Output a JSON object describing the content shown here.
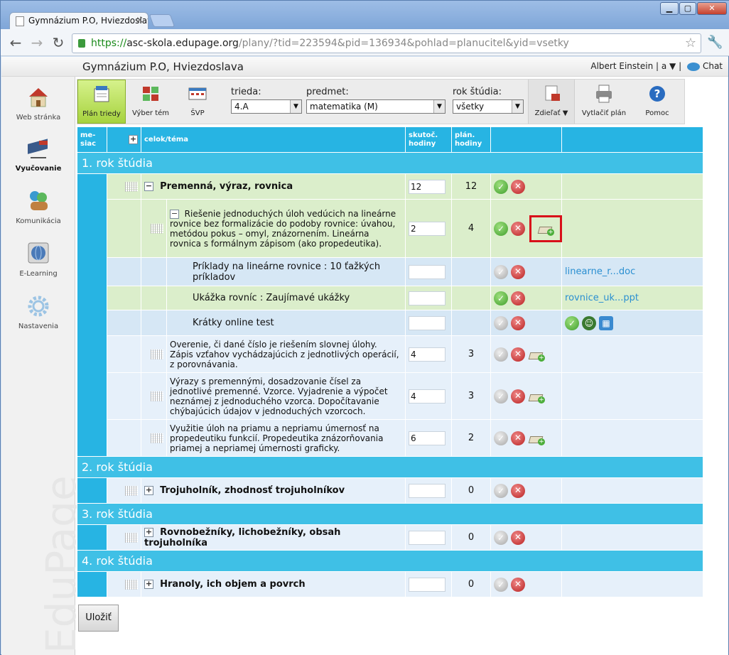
{
  "browser": {
    "tab_title": "Gymnázium P.O, Hviezdoslava",
    "url_scheme": "https://",
    "url_host": "asc-skola.edupage.org",
    "url_path": "/plany/?tid=223594&pid=136934&pohlad=planucitel&yid=vsetky"
  },
  "header": {
    "school": "Gymnázium P.O, Hviezdoslava",
    "user": "Albert Einstein",
    "user_menu": "| a ▼ |",
    "chat": "Chat"
  },
  "sidebar": [
    {
      "label": "Web stránka",
      "icon": "house-icon"
    },
    {
      "label": "Vyučovanie",
      "icon": "teaching-icon",
      "active": true
    },
    {
      "label": "Komunikácia",
      "icon": "people-icon"
    },
    {
      "label": "E-Learning",
      "icon": "globe-icon"
    },
    {
      "label": "Nastavenia",
      "icon": "gear-icon"
    }
  ],
  "watermark": "EduPage",
  "ribbon": {
    "plan_triedy": "Plán triedy",
    "vyber_tem": "Výber tém",
    "svp": "ŠVP",
    "trieda_label": "trieda:",
    "trieda_value": "4.A",
    "predmet_label": "predmet:",
    "predmet_value": "matematika (M)",
    "rok_label": "rok štúdia:",
    "rok_value": "všetky",
    "zdielat": "Zdieľať ▼",
    "vytlacit": "Vytlačiť plán",
    "pomoc": "Pomoc"
  },
  "table": {
    "col_mesiac": "me-siac",
    "col_celok": "celok/téma",
    "col_skutoc": "skutoč. hodiny",
    "col_plan": "plán. hodiny",
    "years": [
      "1. rok štúdia",
      "2. rok štúdia",
      "3. rok štúdia",
      "4. rok štúdia"
    ],
    "rows": {
      "r1": {
        "text": "Premenná, výraz, rovnica",
        "skutoc": "12",
        "plan": "12"
      },
      "r2": {
        "text": "Riešenie jednoduchých úloh vedúcich na lineárne rovnice bez formalizácie do podoby rovnice: úvahou, metódou pokus – omyl, znázornením. Lineárna rovnica s formálnym zápisom (ako propedeutika).",
        "skutoc": "2",
        "plan": "4"
      },
      "r3": {
        "text": "Príklady na lineárne rovnice : 10 ťažkých príkladov",
        "link": "linearne_r...doc"
      },
      "r4": {
        "text": "Ukážka rovníc : Zaujímavé ukážky",
        "link": "rovnice_uk...ppt"
      },
      "r5": {
        "text": "Krátky online test"
      },
      "r6": {
        "text": "Overenie, či dané číslo je riešením slovnej úlohy. Zápis vzťahov vychádzajúcich z jednotlivých operácií, z porovnávania.",
        "skutoc": "4",
        "plan": "3"
      },
      "r7": {
        "text": "Výrazy s premennými, dosadzovanie čísel za jednotlivé premenné. Vzorce. Vyjadrenie a výpočet neznámej z jednoduchého vzorca. Dopočítavanie chýbajúcich údajov v jednoduchých vzorcoch.",
        "skutoc": "4",
        "plan": "3"
      },
      "r8": {
        "text": "Využitie úloh na priamu a nepriamu úmernosť na propedeutiku funkcií. Propedeutika znázorňovania priamej a nepriamej úmernosti graficky.",
        "skutoc": "6",
        "plan": "2"
      },
      "r9": {
        "text": "Trojuholník, zhodnosť trojuholníkov",
        "plan": "0"
      },
      "r10": {
        "text": "Rovnobežníky, lichobežníky, obsah trojuholníka",
        "plan": "0"
      },
      "r11": {
        "text": "Hranoly, ich objem a povrch",
        "plan": "0"
      }
    }
  },
  "save_button": "Uložiť"
}
